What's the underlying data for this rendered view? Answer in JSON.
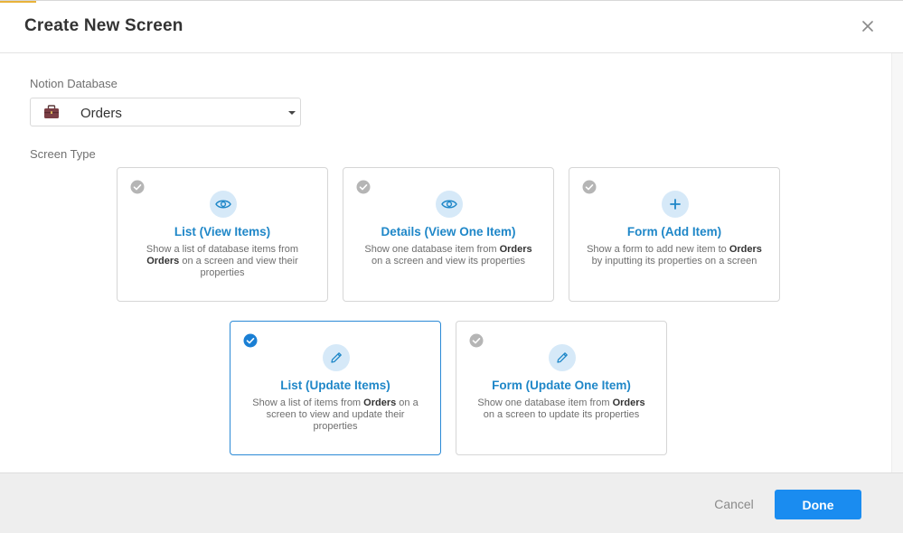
{
  "dialog": {
    "title": "Create New Screen"
  },
  "database_field": {
    "label": "Notion Database",
    "selected": "Orders",
    "icon": "briefcase-icon"
  },
  "screen_type": {
    "label": "Screen Type",
    "options": [
      {
        "title": "List (View Items)",
        "icon": "eye-icon",
        "desc_pre": "Show a list of database items from ",
        "desc_bold": "Orders",
        "desc_post": " on a screen and view their properties",
        "selected": false
      },
      {
        "title": "Details (View One Item)",
        "icon": "eye-icon",
        "desc_pre": "Show one database item from ",
        "desc_bold": "Orders",
        "desc_post": " on a screen and view its properties",
        "selected": false
      },
      {
        "title": "Form (Add Item)",
        "icon": "plus-icon",
        "desc_pre": "Show a form to add new item to ",
        "desc_bold": "Orders",
        "desc_post": " by inputting its properties on a screen",
        "selected": false
      },
      {
        "title": "List (Update Items)",
        "icon": "pencil-icon",
        "desc_pre": "Show a list of items from ",
        "desc_bold": "Orders",
        "desc_post": " on a screen to view and update their properties",
        "selected": true
      },
      {
        "title": "Form (Update One Item)",
        "icon": "pencil-icon",
        "desc_pre": "Show one database item from ",
        "desc_bold": "Orders",
        "desc_post": " on a screen to update its properties",
        "selected": false
      }
    ]
  },
  "footer": {
    "cancel_label": "Cancel",
    "done_label": "Done"
  },
  "colors": {
    "accent": "#1f87c8",
    "primary_button": "#1a8cf0",
    "selected_border": "#2b8ad6",
    "icon_bg": "#d6e9f8"
  }
}
